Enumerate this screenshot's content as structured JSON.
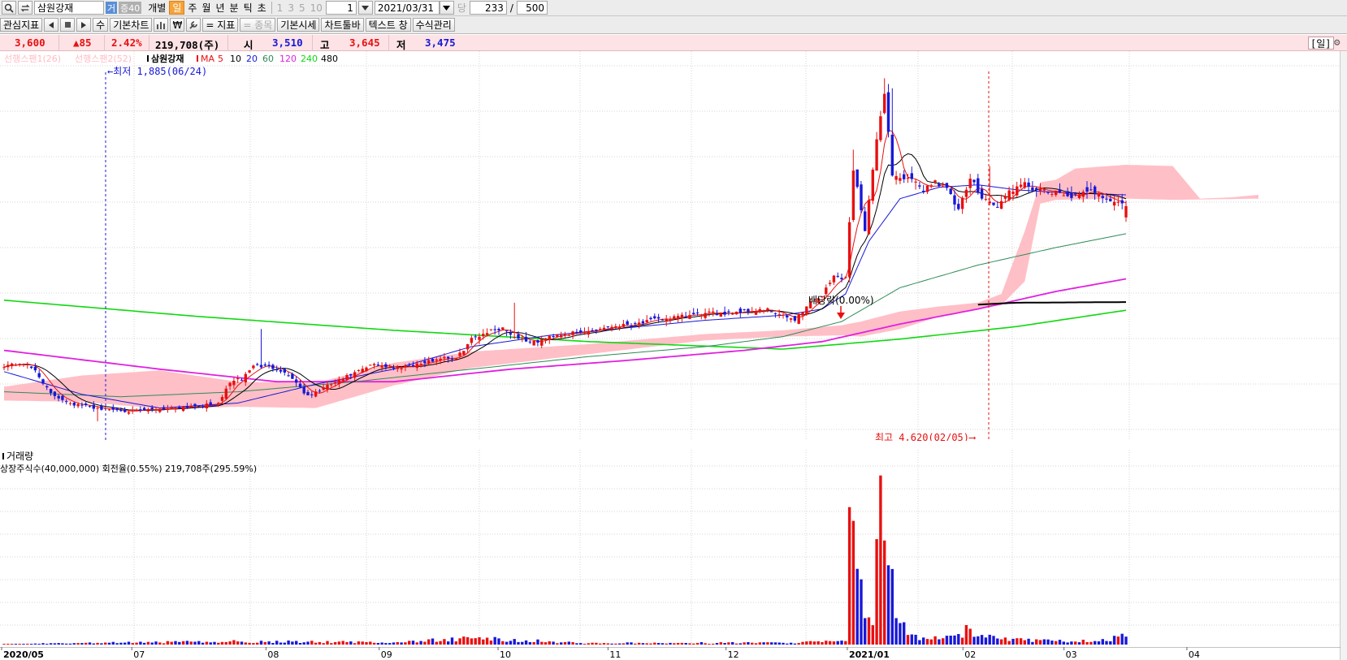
{
  "toolbar": {
    "stock_name": "삼원강재",
    "tag_geo": "거",
    "tag_jeung": "증40",
    "mode_individual": "개별",
    "periods": [
      "일",
      "주",
      "월",
      "년",
      "분",
      "틱",
      "초"
    ],
    "selected_period": "일",
    "nums": [
      "1",
      "3",
      "5",
      "10"
    ],
    "interval_value": "1",
    "date_value": "2021/03/31",
    "dang_label": "당",
    "count_value": "233",
    "slash": "/",
    "total_value": "500",
    "row2": {
      "interest_indicator": "관심지표",
      "su_label": "수",
      "basic_chart": "기본차트",
      "won_label": "₩",
      "indicator": "= 지표",
      "item": "= 종목",
      "basic_quote": "기본시세",
      "chart_toolbar": "차트툴바",
      "text_label": "텍스트 창",
      "formula_manage": "수식관리"
    }
  },
  "quote": {
    "price": "3,600",
    "change": "▲85",
    "change_rate": "2.42%",
    "volume": "219,708(주)",
    "open_label": "시",
    "open": "3,510",
    "high_label": "고",
    "high": "3,645",
    "low_label": "저",
    "low": "3,475",
    "period_tag": "[일]"
  },
  "legend": {
    "span1": "선행스팬1(26)",
    "span2": "선행스팬2(52)",
    "stock": "삼원강재",
    "ma_label": "MA",
    "ma_periods": [
      "5",
      "10",
      "20",
      "60",
      "120",
      "240",
      "480"
    ],
    "ma_colors": [
      "#e81010",
      "#000000",
      "#1818d8",
      "#2e8b57",
      "#e020e0",
      "#10d810",
      "#000000"
    ]
  },
  "annotations": {
    "low_marker": "←최저 1,885(06/24)",
    "high_marker": "최고 4,620(02/05)⟶",
    "dividend": "배당락(0.00%)"
  },
  "volume_panel": {
    "title": "거래량",
    "info": "상장주식수(40,000,000) 회전율(0.55%) 219,708주(295.59%)"
  },
  "colors": {
    "up": "#e81010",
    "down": "#1818d8",
    "cloud": "#ffbcc4",
    "grid": "#d4d4d4",
    "ma5": "#e81010",
    "ma10": "#000000",
    "ma20": "#1818d8",
    "ma60": "#2e8b57",
    "ma120": "#e020e0",
    "ma240": "#10d810",
    "ma480": "#000000"
  },
  "chart_data": {
    "type": "candlestick",
    "x_ticks": [
      "2020/05",
      "07",
      "08",
      "09",
      "10",
      "11",
      "12",
      "2021/01",
      "02",
      "03",
      "04"
    ],
    "price_range": [
      1800,
      4700
    ],
    "last": {
      "date": "2021/03/31",
      "open": 3510,
      "high": 3645,
      "low": 3475,
      "close": 3600,
      "volume": 219708
    },
    "extremes": {
      "low": {
        "value": 1885,
        "date": "06/24"
      },
      "high": {
        "value": 4620,
        "date": "02/05"
      }
    },
    "anchors": {
      "close": [
        [
          0,
          2330
        ],
        [
          5,
          2350
        ],
        [
          8,
          2290
        ],
        [
          12,
          2100
        ],
        [
          18,
          2020
        ],
        [
          25,
          1985
        ],
        [
          33,
          1965
        ],
        [
          42,
          1990
        ],
        [
          50,
          2010
        ],
        [
          55,
          2020
        ],
        [
          58,
          2200
        ],
        [
          61,
          2220
        ],
        [
          64,
          2330
        ],
        [
          70,
          2310
        ],
        [
          74,
          2230
        ],
        [
          78,
          2080
        ],
        [
          82,
          2150
        ],
        [
          88,
          2240
        ],
        [
          95,
          2340
        ],
        [
          100,
          2310
        ],
        [
          108,
          2350
        ],
        [
          113,
          2400
        ],
        [
          116,
          2380
        ],
        [
          120,
          2540
        ],
        [
          124,
          2600
        ],
        [
          128,
          2630
        ],
        [
          131,
          2560
        ],
        [
          136,
          2510
        ],
        [
          142,
          2580
        ],
        [
          148,
          2590
        ],
        [
          155,
          2640
        ],
        [
          161,
          2660
        ],
        [
          167,
          2690
        ],
        [
          172,
          2710
        ],
        [
          179,
          2740
        ],
        [
          185,
          2750
        ],
        [
          192,
          2770
        ],
        [
          196,
          2770
        ],
        [
          200,
          2720
        ],
        [
          203,
          2700
        ],
        [
          207,
          2830
        ],
        [
          210,
          2890
        ],
        [
          213,
          3040
        ],
        [
          216,
          3030
        ],
        [
          218,
          3900
        ],
        [
          221,
          3420
        ],
        [
          224,
          4110
        ],
        [
          226,
          4520
        ],
        [
          228,
          3850
        ],
        [
          230,
          3830
        ],
        [
          233,
          3800
        ],
        [
          236,
          3730
        ],
        [
          239,
          3800
        ],
        [
          242,
          3740
        ],
        [
          245,
          3560
        ],
        [
          248,
          3820
        ],
        [
          251,
          3680
        ],
        [
          255,
          3590
        ],
        [
          258,
          3720
        ],
        [
          262,
          3770
        ],
        [
          266,
          3720
        ],
        [
          268,
          3710
        ],
        [
          270,
          3700
        ],
        [
          275,
          3680
        ],
        [
          280,
          3720
        ],
        [
          284,
          3650
        ],
        [
          288,
          3600
        ]
      ],
      "volume": [
        [
          0,
          3
        ],
        [
          60,
          18
        ],
        [
          100,
          12
        ],
        [
          120,
          35
        ],
        [
          150,
          8
        ],
        [
          200,
          10
        ],
        [
          216,
          20
        ],
        [
          217,
          780
        ],
        [
          219,
          430
        ],
        [
          221,
          150
        ],
        [
          223,
          110
        ],
        [
          225,
          960
        ],
        [
          227,
          450
        ],
        [
          229,
          150
        ],
        [
          232,
          55
        ],
        [
          236,
          40
        ],
        [
          240,
          30
        ],
        [
          245,
          60
        ],
        [
          248,
          90
        ],
        [
          252,
          40
        ],
        [
          256,
          30
        ],
        [
          262,
          25
        ],
        [
          270,
          20
        ],
        [
          280,
          20
        ],
        [
          288,
          45
        ]
      ]
    },
    "moving_averages": {
      "ma20": [
        [
          0,
          2280
        ],
        [
          20,
          2100
        ],
        [
          40,
          1990
        ],
        [
          60,
          2030
        ],
        [
          80,
          2180
        ],
        [
          100,
          2300
        ],
        [
          120,
          2480
        ],
        [
          140,
          2570
        ],
        [
          160,
          2630
        ],
        [
          180,
          2690
        ],
        [
          200,
          2730
        ],
        [
          210,
          2780
        ],
        [
          216,
          2900
        ],
        [
          222,
          3320
        ],
        [
          230,
          3660
        ],
        [
          240,
          3750
        ],
        [
          250,
          3770
        ],
        [
          260,
          3730
        ],
        [
          270,
          3710
        ],
        [
          288,
          3690
        ]
      ],
      "ma60": [
        [
          0,
          2120
        ],
        [
          30,
          2080
        ],
        [
          60,
          2120
        ],
        [
          90,
          2200
        ],
        [
          120,
          2300
        ],
        [
          150,
          2400
        ],
        [
          180,
          2480
        ],
        [
          200,
          2560
        ],
        [
          215,
          2680
        ],
        [
          230,
          2950
        ],
        [
          250,
          3130
        ],
        [
          270,
          3270
        ],
        [
          288,
          3380
        ]
      ],
      "ma120": [
        [
          0,
          2450
        ],
        [
          40,
          2300
        ],
        [
          70,
          2200
        ],
        [
          100,
          2200
        ],
        [
          130,
          2300
        ],
        [
          160,
          2370
        ],
        [
          190,
          2450
        ],
        [
          210,
          2520
        ],
        [
          230,
          2660
        ],
        [
          250,
          2780
        ],
        [
          270,
          2920
        ],
        [
          288,
          3020
        ]
      ],
      "ma240": [
        [
          0,
          2850
        ],
        [
          50,
          2720
        ],
        [
          100,
          2610
        ],
        [
          150,
          2520
        ],
        [
          200,
          2460
        ],
        [
          230,
          2540
        ],
        [
          260,
          2640
        ],
        [
          288,
          2770
        ]
      ],
      "ma480": [
        [
          250,
          2815
        ],
        [
          260,
          2830
        ],
        [
          288,
          2835
        ]
      ]
    },
    "ichimoku_cloud": {
      "upper": [
        [
          0,
          2160
        ],
        [
          20,
          2250
        ],
        [
          40,
          2290
        ],
        [
          60,
          2200
        ],
        [
          80,
          2190
        ],
        [
          100,
          2350
        ],
        [
          120,
          2440
        ],
        [
          150,
          2500
        ],
        [
          180,
          2580
        ],
        [
          200,
          2610
        ],
        [
          215,
          2650
        ],
        [
          220,
          2680
        ],
        [
          230,
          2760
        ],
        [
          240,
          2800
        ],
        [
          250,
          2830
        ],
        [
          256,
          2900
        ],
        [
          262,
          3400
        ],
        [
          266,
          3790
        ],
        [
          270,
          3810
        ],
        [
          275,
          3900
        ],
        [
          288,
          3930
        ],
        [
          300,
          3920
        ],
        [
          307,
          3660
        ],
        [
          315,
          3670
        ],
        [
          322,
          3690
        ]
      ],
      "lower": [
        [
          0,
          2050
        ],
        [
          20,
          2040
        ],
        [
          40,
          1985
        ],
        [
          60,
          2000
        ],
        [
          80,
          1990
        ],
        [
          100,
          2170
        ],
        [
          120,
          2310
        ],
        [
          150,
          2420
        ],
        [
          180,
          2530
        ],
        [
          200,
          2560
        ],
        [
          215,
          2570
        ],
        [
          220,
          2560
        ],
        [
          230,
          2620
        ],
        [
          240,
          2720
        ],
        [
          250,
          2780
        ],
        [
          256,
          2810
        ],
        [
          262,
          3000
        ],
        [
          266,
          3620
        ],
        [
          270,
          3650
        ],
        [
          288,
          3660
        ],
        [
          300,
          3650
        ],
        [
          322,
          3660
        ]
      ]
    }
  }
}
